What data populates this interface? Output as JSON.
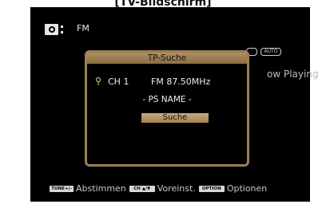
{
  "page_header": "[TV-Bildschirm]",
  "background": {
    "source_label": "FM",
    "badges": [
      "",
      "AUTO"
    ],
    "now_playing": "ow Playing"
  },
  "dialog": {
    "title": "TP-Suche",
    "channel": "CH 1",
    "frequency": "FM 87.50MHz",
    "ps_name": "- PS NAME -",
    "search_button": "Suche"
  },
  "footer": {
    "tune_key": "TUNE+/-",
    "tune_label": "Abstimmen",
    "ch_key": "CH ▲/▼",
    "ch_label": "Voreinst.",
    "option_key": "OPTION",
    "option_label": "Optionen"
  },
  "colors": {
    "dialog_border": "#9b7f55",
    "title_bar": "#b08f62",
    "screen_bg": "#000000"
  },
  "icons": [
    "tuner-icon",
    "antenna-icon"
  ]
}
